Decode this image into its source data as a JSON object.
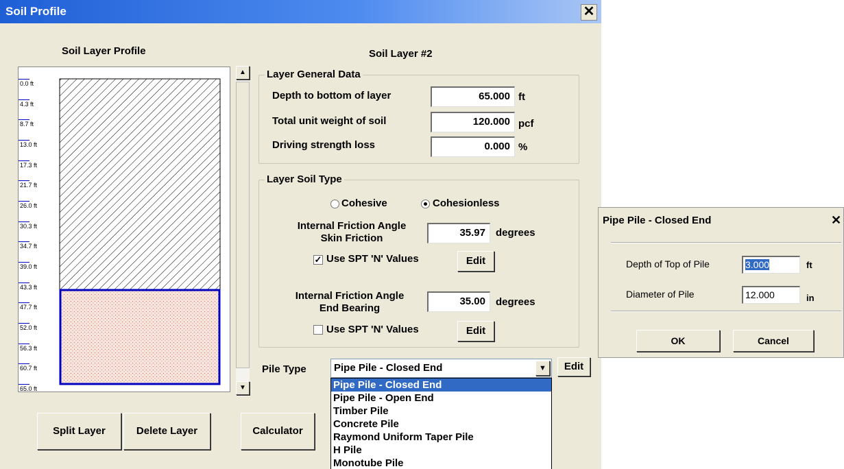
{
  "main_window": {
    "title": "Soil Profile",
    "close_glyph": "✕",
    "profile_heading": "Soil Layer Profile",
    "layer_heading": "Soil Layer #2",
    "depth_ticks": [
      "0.0 ft",
      "4.3 ft",
      "8.7 ft",
      "13.0 ft",
      "17.3 ft",
      "21.7 ft",
      "26.0 ft",
      "30.3 ft",
      "34.7 ft",
      "39.0 ft",
      "43.3 ft",
      "47.7 ft",
      "52.0 ft",
      "56.3 ft",
      "60.7 ft",
      "65.0 ft"
    ],
    "general": {
      "group_title": "Layer General Data",
      "depth_label": "Depth to bottom of layer",
      "depth_value": "65.000",
      "depth_unit": "ft",
      "weight_label": "Total unit weight of soil",
      "weight_value": "120.000",
      "weight_unit": "pcf",
      "loss_label": "Driving strength loss",
      "loss_value": "0.000",
      "loss_unit": "%"
    },
    "soil_type": {
      "group_title": "Layer Soil Type",
      "cohesive_label": "Cohesive",
      "cohesionless_label": "Cohesionless",
      "selected": "Cohesionless",
      "skin_label_1": "Internal Friction Angle",
      "skin_label_2": "Skin Friction",
      "skin_value": "35.97",
      "skin_unit": "degrees",
      "skin_spt_label": "Use SPT 'N' Values",
      "skin_spt_checked": true,
      "end_label_1": "Internal Friction Angle",
      "end_label_2": "End Bearing",
      "end_value": "35.00",
      "end_unit": "degrees",
      "end_spt_label": "Use SPT 'N' Values",
      "end_spt_checked": false,
      "edit_label": "Edit"
    },
    "pile_type": {
      "label": "Pile Type",
      "selected": "Pipe Pile - Closed End",
      "edit_label": "Edit",
      "options": [
        "Pipe Pile - Closed End",
        "Pipe Pile - Open End",
        "Timber Pile",
        "Concrete Pile",
        "Raymond Uniform Taper Pile",
        "H Pile",
        "Monotube Pile"
      ]
    },
    "buttons": {
      "split": "Split Layer",
      "delete": "Delete Layer",
      "calculator": "Calculator"
    },
    "scroll_up": "▲",
    "scroll_down": "▼",
    "dropdown_arrow": "▼",
    "check_mark": "✓"
  },
  "pipe_dialog": {
    "title": "Pipe Pile - Closed End",
    "close_glyph": "✕",
    "top_label": "Depth of Top of Pile",
    "top_value": "3.000",
    "top_unit": "ft",
    "dia_label": "Diameter of Pile",
    "dia_value": "12.000",
    "dia_unit": "in",
    "ok": "OK",
    "cancel": "Cancel"
  },
  "colors": {
    "title_blue": "#1f5fd6",
    "layer_border": "#0000c0",
    "sand_fill": "#f7e4dc",
    "selection": "#316ac5"
  }
}
